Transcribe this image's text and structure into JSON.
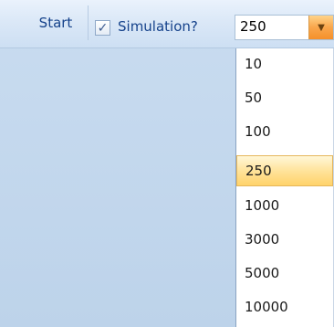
{
  "toolbar": {
    "start_label": "Start",
    "checkbox_checked": true,
    "checkbox_mark": "✓",
    "checkbox_label": "Simulation?",
    "combo_value": "250",
    "combo_arrow_icon": "chevron-down-icon"
  },
  "dropdown": {
    "options": [
      "10",
      "50",
      "100",
      "250",
      "1000",
      "3000",
      "5000",
      "10000"
    ],
    "selected": "250"
  }
}
